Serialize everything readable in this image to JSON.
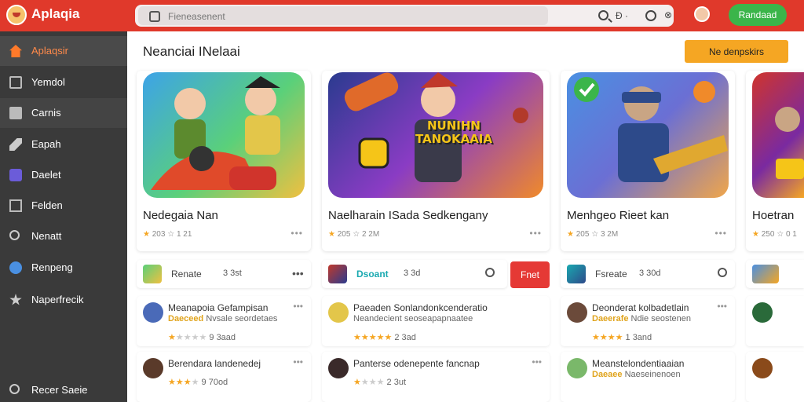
{
  "app": {
    "name": "Aplaqia"
  },
  "search": {
    "placeholder": "Fieneasenent",
    "option_label": "Ð ·",
    "close_label": "⊗"
  },
  "header": {
    "action_button": "Randaad"
  },
  "sidebar": {
    "items": [
      {
        "label": "Aplaqsir",
        "icon": "home-icon"
      },
      {
        "label": "Yemdol",
        "icon": "square-icon"
      },
      {
        "label": "Carnis",
        "icon": "card-icon"
      },
      {
        "label": "Eapah",
        "icon": "arrow-icon"
      },
      {
        "label": "Daelet",
        "icon": "purple-icon"
      },
      {
        "label": "Felden",
        "icon": "grid-icon"
      },
      {
        "label": "Nenatt",
        "icon": "search-icon"
      },
      {
        "label": "Renpeng",
        "icon": "blue-icon"
      },
      {
        "label": "Naperfrecik",
        "icon": "star-icon"
      }
    ],
    "bottom": {
      "label": "Recer Saeie",
      "icon": "circle-icon"
    }
  },
  "main": {
    "title": "Neanciai INelaai",
    "top_button": "Ne denpskirs",
    "games": [
      {
        "title": "Nedegaia Nan",
        "meta": "203 ☆ 1 21",
        "banner": ""
      },
      {
        "title": "Naelharain ISada Sedkengany",
        "meta": "205 ☆ 2 2M",
        "banner": "NUNIHN TANOKAAIA"
      },
      {
        "title": "Menhgeo Rieet kan",
        "meta": "205 ☆ 3 2M",
        "banner": ""
      },
      {
        "title": "Hoetran",
        "meta": "250 ☆ 0 1",
        "banner": ""
      }
    ],
    "mini": [
      {
        "name": "Renate",
        "value": "3 3st"
      },
      {
        "name": "Dsoant",
        "value": "3 3d",
        "button": "Fnet"
      },
      {
        "name": "Fsreate",
        "value": "3 30d"
      }
    ],
    "list": [
      {
        "title": "Meanapoia Gefampisan",
        "tag": "Daeceed",
        "sub": "Nvsale seordetaes",
        "rating": "9 3aad"
      },
      {
        "title": "Paeaden Sonlandonkcenderatio",
        "tag": "",
        "sub": "Neandecient seoseapapnaatee",
        "rating": "2 3ad"
      },
      {
        "title": "Deonderat kolbadetlain",
        "tag": "Daeerafe",
        "sub": "Ndie seostenen",
        "rating": "1 3and"
      },
      {
        "title": "Berendara landenedej",
        "tag": "",
        "sub": "",
        "rating": "9 70od"
      },
      {
        "title": "Panterse odenepente fancnap",
        "tag": "",
        "sub": "",
        "rating": "2 3ut"
      },
      {
        "title": "Meanstelondentiaaian",
        "tag": "Daeaee",
        "sub": "Naeseinenoen",
        "rating": ""
      }
    ]
  }
}
